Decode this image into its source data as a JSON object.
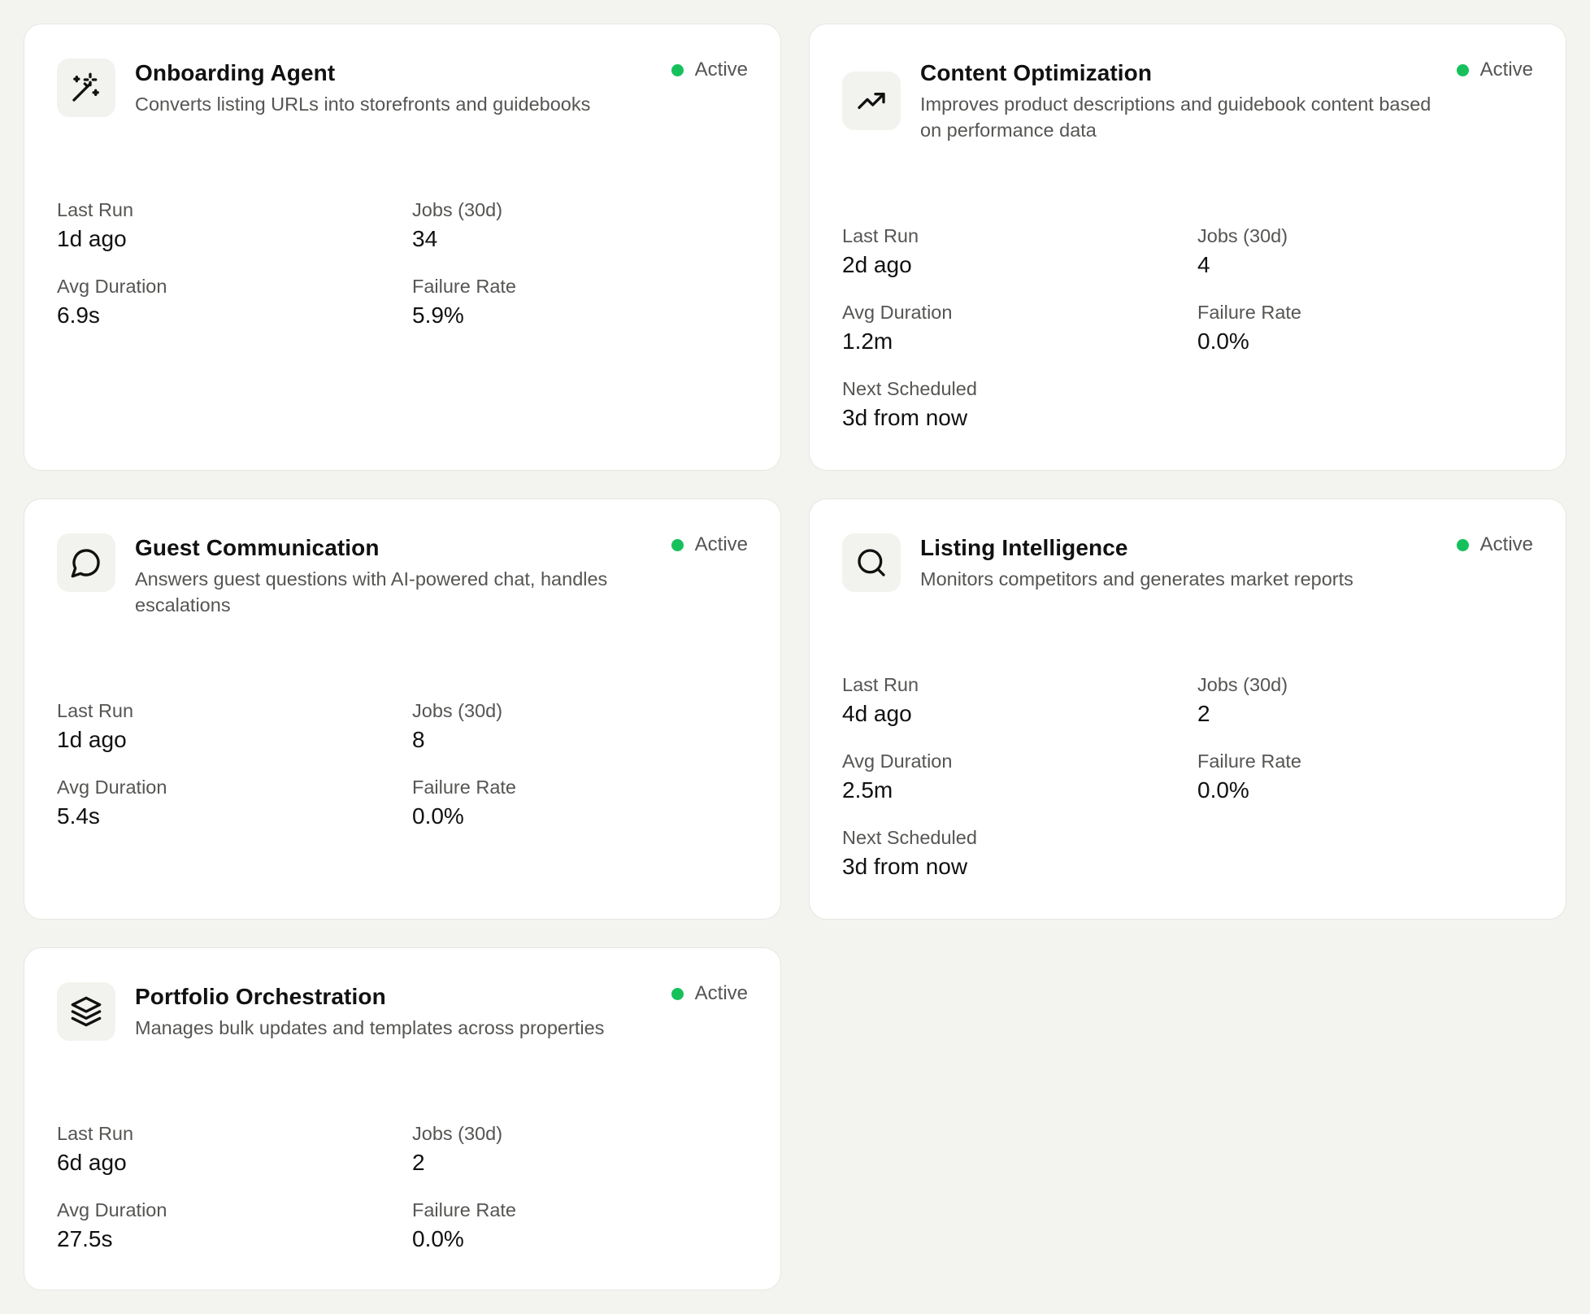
{
  "labels": {
    "last_run": "Last Run",
    "jobs": "Jobs (30d)",
    "avg_duration": "Avg Duration",
    "failure_rate": "Failure Rate",
    "next_scheduled": "Next Scheduled"
  },
  "status_color": "#16c15c",
  "agents": [
    {
      "icon": "magic-wand-icon",
      "title": "Onboarding Agent",
      "description": "Converts listing URLs into storefronts and guidebooks",
      "status": "Active",
      "last_run": "1d ago",
      "jobs": "34",
      "avg_duration": "6.9s",
      "failure_rate": "5.9%"
    },
    {
      "icon": "trending-up-icon",
      "title": "Content Optimization",
      "description": "Improves product descriptions and guidebook content based on performance data",
      "status": "Active",
      "last_run": "2d ago",
      "jobs": "4",
      "avg_duration": "1.2m",
      "failure_rate": "0.0%",
      "next_scheduled": "3d from now"
    },
    {
      "icon": "chat-bubble-icon",
      "title": "Guest Communication",
      "description": "Answers guest questions with AI-powered chat, handles escalations",
      "status": "Active",
      "last_run": "1d ago",
      "jobs": "8",
      "avg_duration": "5.4s",
      "failure_rate": "0.0%"
    },
    {
      "icon": "search-icon",
      "title": "Listing Intelligence",
      "description": "Monitors competitors and generates market reports",
      "status": "Active",
      "last_run": "4d ago",
      "jobs": "2",
      "avg_duration": "2.5m",
      "failure_rate": "0.0%",
      "next_scheduled": "3d from now"
    },
    {
      "icon": "layers-icon",
      "title": "Portfolio Orchestration",
      "description": "Manages bulk updates and templates across properties",
      "status": "Active",
      "last_run": "6d ago",
      "jobs": "2",
      "avg_duration": "27.5s",
      "failure_rate": "0.0%"
    }
  ]
}
